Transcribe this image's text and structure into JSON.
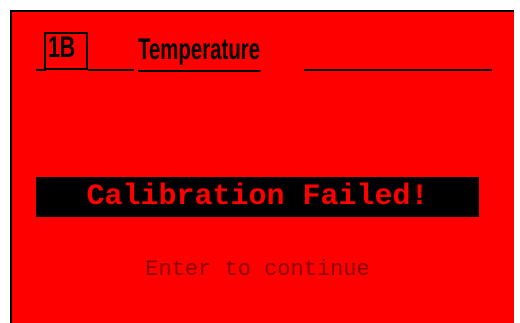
{
  "header": {
    "channel_label": "1B",
    "title": "Temperature"
  },
  "alert": {
    "message": "Calibration Failed!"
  },
  "prompt": {
    "text": "Enter to continue"
  },
  "colors": {
    "background": "#ff0000",
    "alert_background": "#000000",
    "alert_text": "#ff0000",
    "prompt_text": "#8a0000",
    "text": "#000000"
  }
}
